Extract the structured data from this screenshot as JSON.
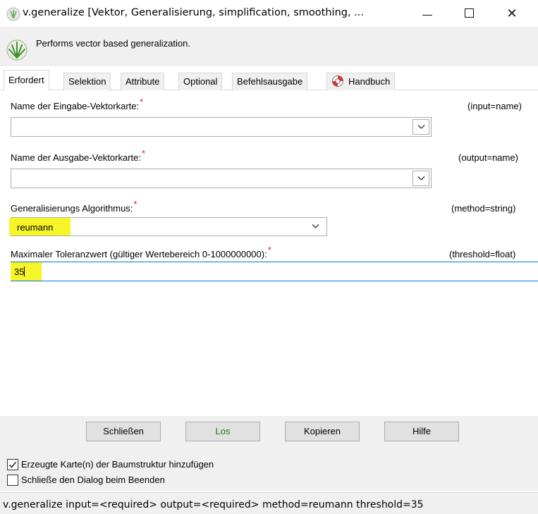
{
  "window": {
    "title": "v.generalize [Vektor, Generalisierung, simplification, smoothing, ...",
    "minimize_icon": "minimize-icon",
    "maximize_icon": "maximize-icon",
    "close_glyph": "✕"
  },
  "header": {
    "description": "Performs vector based generalization."
  },
  "tabs": [
    {
      "label": "Erfordert",
      "active": true
    },
    {
      "label": "Selektion"
    },
    {
      "label": "Attribute"
    },
    {
      "label": "Optional"
    },
    {
      "label": "Befehlsausgabe"
    },
    {
      "label": "Handbuch",
      "icon": "lifebuoy-icon"
    }
  ],
  "fields": {
    "input": {
      "label": "Name der Eingabe-Vektorkarte:",
      "hint": "(input=name)",
      "value": ""
    },
    "output": {
      "label": "Name der Ausgabe-Vektorkarte:",
      "hint": "(output=name)",
      "value": ""
    },
    "method": {
      "label": "Generalisierungs Algorithmus:",
      "hint": "(method=string)",
      "value": "reumann"
    },
    "threshold": {
      "label": "Maximaler Toleranzwert (gültiger Wertebereich 0-1000000000):",
      "hint": "(threshold=float)",
      "value": "35"
    }
  },
  "required_marker": "*",
  "buttons": {
    "close": "Schließen",
    "run": "Los",
    "copy": "Kopieren",
    "help": "Hilfe"
  },
  "options": {
    "add_to_tree": {
      "label": "Erzeugte Karte(n) der Baumstruktur hinzufügen",
      "checked": true
    },
    "close_on_finish": {
      "label": "Schließe den Dialog beim Beenden",
      "checked": false
    }
  },
  "status": {
    "command": "v.generalize input=<required> output=<required> method=reumann threshold=35"
  },
  "colors": {
    "highlight": "#f5f52a",
    "required": "#e02020",
    "focus": "#0078d7",
    "run_text": "#1b7a1b"
  }
}
